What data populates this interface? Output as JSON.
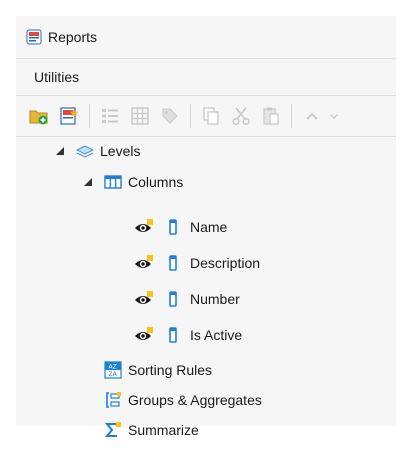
{
  "window": {
    "title": "Reports"
  },
  "menu": {
    "items": [
      {
        "label": "Utilities"
      }
    ]
  },
  "toolbar": {
    "buttons": [
      {
        "icon": "add-folder-icon",
        "enabled": true
      },
      {
        "icon": "add-report-icon",
        "enabled": true
      },
      {
        "icon": "list-icon",
        "enabled": false
      },
      {
        "icon": "table-icon",
        "enabled": false
      },
      {
        "icon": "tag-icon",
        "enabled": false
      },
      {
        "icon": "copy-icon",
        "enabled": false
      },
      {
        "icon": "cut-icon",
        "enabled": false
      },
      {
        "icon": "paste-icon",
        "enabled": false
      },
      {
        "icon": "move-up-icon",
        "enabled": false
      },
      {
        "icon": "move-down-icon",
        "enabled": false
      }
    ]
  },
  "tree": {
    "levels": {
      "label": "Levels",
      "expanded": true
    },
    "columns": {
      "label": "Columns",
      "expanded": true
    },
    "fields": [
      {
        "label": "Name"
      },
      {
        "label": "Description"
      },
      {
        "label": "Number"
      },
      {
        "label": "Is Active"
      }
    ],
    "sorting_rules": {
      "label": "Sorting Rules"
    },
    "groups_aggregates": {
      "label": "Groups & Aggregates"
    },
    "summarize": {
      "label": "Summarize"
    }
  },
  "colors": {
    "panel_bg": "#f6f6f6",
    "accent_blue": "#1e7fd6",
    "eye_badge": "#f5c518",
    "disabled_icon": "#c8c8c8"
  }
}
